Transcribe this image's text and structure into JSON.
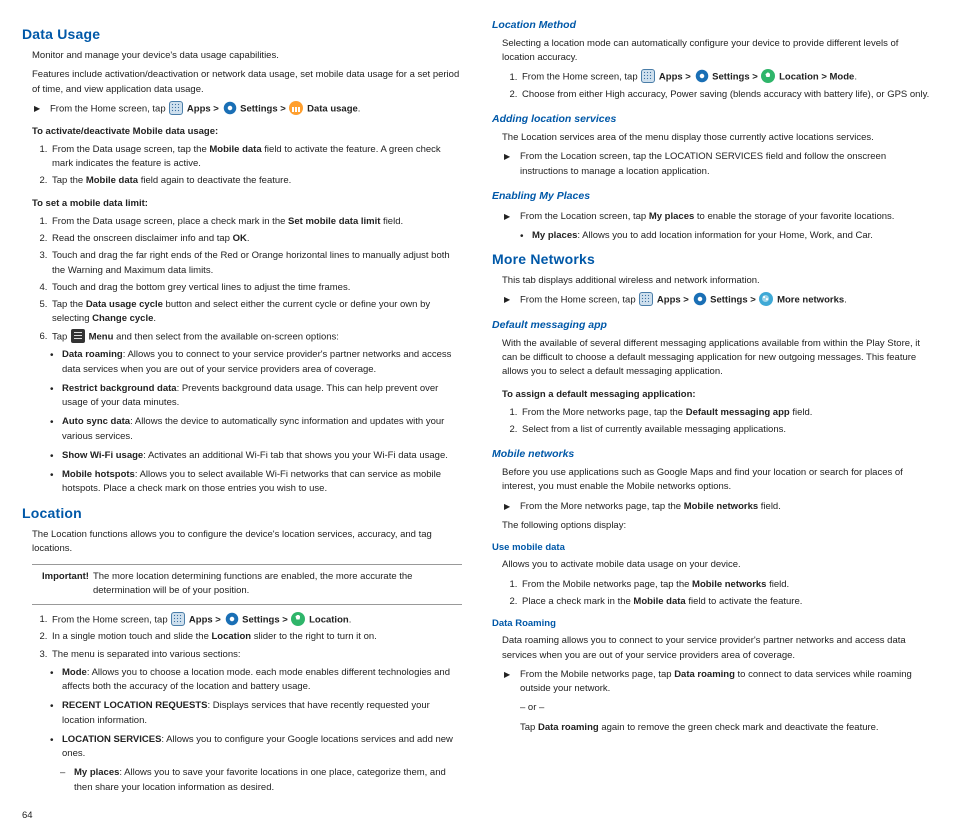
{
  "page_number": "64",
  "icons": {
    "apps": "Apps >",
    "settings": "Settings >",
    "data_usage": "Data usage",
    "menu": "Menu",
    "location": "Location",
    "more_networks": "More networks",
    "location_mode": "Location > Mode"
  },
  "left": {
    "data_usage": {
      "title": "Data Usage",
      "intro1": "Monitor and manage your device's data usage capabilities.",
      "intro2": "Features include activation/deactivation or network data usage, set mobile data usage for a set period of time, and view application data usage.",
      "arrow_from_home": "From the Home screen, tap ",
      "sub1_title": "To activate/deactivate Mobile data usage:",
      "sub1_li1a": "From the Data usage screen, tap the ",
      "sub1_li1b": "Mobile data",
      "sub1_li1c": " field to activate the feature. A green check mark indicates the feature is active.",
      "sub1_li2a": "Tap the ",
      "sub1_li2b": "Mobile data",
      "sub1_li2c": " field again to deactivate the feature.",
      "sub2_title": "To set a mobile data limit:",
      "sub2_li1a": "From the Data usage screen, place a check mark in the ",
      "sub2_li1b": "Set mobile data limit",
      "sub2_li1c": " field.",
      "sub2_li2a": "Read the onscreen disclaimer info and tap ",
      "sub2_li2b": "OK",
      "sub2_li2c": ".",
      "sub2_li3": "Touch and drag the far right ends of the Red or Orange horizontal lines to manually adjust both the Warning and Maximum data limits.",
      "sub2_li4": "Touch and drag the bottom grey vertical lines to adjust the time frames.",
      "sub2_li5a": "Tap the ",
      "sub2_li5b": "Data usage cycle",
      "sub2_li5c": " button and select either the current cycle or define your own by selecting ",
      "sub2_li5d": "Change cycle",
      "sub2_li5e": ".",
      "sub2_li6a": "Tap ",
      "sub2_li6c": " and then select from the available on-screen options:",
      "opt1a": "Data roaming",
      "opt1b": ": Allows you to connect to your service provider's partner networks and access data services when you are out of your service providers area of coverage.",
      "opt2a": "Restrict background data",
      "opt2b": ": Prevents background data usage. This can help prevent over usage of your data minutes.",
      "opt3a": "Auto sync data",
      "opt3b": ": Allows the device to automatically sync information and updates with your various services.",
      "opt4a": "Show Wi-Fi usage",
      "opt4b": ": Activates an additional Wi-Fi tab that shows you your Wi-Fi data usage.",
      "opt5a": "Mobile hotspots",
      "opt5b": ": Allows you to select available Wi-Fi networks that can service as mobile hotspots. Place a check mark on those entries you wish to use."
    },
    "location": {
      "title": "Location",
      "intro": "The Location functions allows you to configure the device's location services, accuracy, and tag locations.",
      "note_label": "Important!",
      "note_text": "The more location determining functions are enabled, the more accurate the determination will be of your position.",
      "li1": "From the Home screen, tap ",
      "li2a": "In a single motion touch and slide the ",
      "li2b": "Location",
      "li2c": " slider to the right to turn it on.",
      "li3": "The menu is separated into various sections:",
      "b1a": "Mode",
      "b1b": ": Allows you to choose a location mode. each mode enables different technologies and affects both the accuracy of the location and battery usage.",
      "b2a": "RECENT LOCATION REQUESTS",
      "b2b": ": Displays services that have recently requested your location information.",
      "b3a": "LOCATION SERVICES",
      "b3b": ": Allows you to configure your Google locations services and add new ones.",
      "d1a": "My places",
      "d1b": ": Allows you to save your favorite locations in one place, categorize them, and then share your location information as desired."
    }
  },
  "right": {
    "location_method": {
      "title": "Location Method",
      "intro": "Selecting a location mode can automatically configure your device to provide different levels of location accuracy.",
      "li1": "From the Home screen, tap ",
      "li2": "Choose from either High accuracy, Power saving (blends accuracy with battery life), or GPS only."
    },
    "adding_loc": {
      "title": "Adding location services",
      "intro": "The Location services area of the menu display those currently active locations services.",
      "arrow": "From the Location screen, tap the LOCATION SERVICES field and follow the onscreen instructions to manage a location application."
    },
    "my_places": {
      "title": "Enabling My Places",
      "arrowa": "From the Location screen, tap ",
      "arrowb": "My places",
      "arrowc": " to enable the storage of your favorite locations.",
      "b1a": "My places",
      "b1b": ": Allows you to add location information for your Home, Work, and Car."
    },
    "more_net": {
      "title": "More Networks",
      "intro": "This tab displays additional wireless and network information.",
      "arrow": "From the Home screen, tap "
    },
    "def_msg": {
      "title": "Default messaging app",
      "intro": "With the available of several different messaging applications available from within the Play Store, it can be difficult to choose a default messaging application for new outgoing messages. This feature allows you to select a default messaging application.",
      "subhead": "To assign a default messaging application:",
      "li1a": "From the More networks page, tap the ",
      "li1b": "Default messaging app",
      "li1c": " field.",
      "li2": "Select from a list of currently available messaging applications."
    },
    "mobile_net": {
      "title": "Mobile networks",
      "intro": "Before you use applications such as Google Maps and find your location or search for places of interest, you must enable the Mobile networks options.",
      "arrowa": "From the More networks page, tap the ",
      "arrowb": "Mobile networks",
      "arrowc": " field.",
      "follow": "The following options display:",
      "umd_title": "Use mobile data",
      "umd_intro": "Allows you to activate mobile data usage on your device.",
      "umd_li1a": "From the Mobile networks page, tap the ",
      "umd_li1b": "Mobile networks",
      "umd_li1c": " field.",
      "umd_li2a": "Place a check mark in the ",
      "umd_li2b": "Mobile data",
      "umd_li2c": " field to activate the feature.",
      "dr_title": "Data Roaming",
      "dr_intro": "Data roaming allows you to connect to your service provider's partner networks and access data services when you are out of your service providers area of coverage.",
      "dr_arrowa": "From the Mobile networks page, tap ",
      "dr_arrowb": "Data roaming",
      "dr_arrowc": " to connect to data services while roaming outside your network.",
      "or": "– or –",
      "dr_tapa": "Tap ",
      "dr_tapb": "Data roaming",
      "dr_tapc": " again to remove the green check mark and deactivate the feature."
    }
  }
}
